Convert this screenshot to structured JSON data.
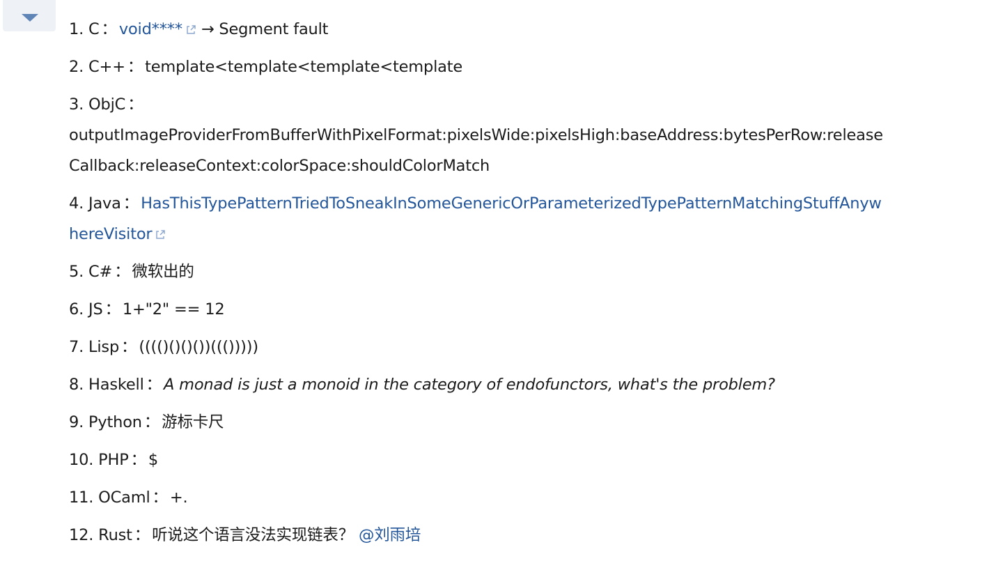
{
  "collapse_button": {
    "icon": "caret-down-icon",
    "color": "#5f84b6"
  },
  "link_color": "#225599",
  "separator": "：",
  "items": [
    {
      "num": "1.",
      "lang": "C",
      "link": "void****",
      "text": " → Segment fault"
    },
    {
      "num": "2.",
      "lang": "C++",
      "text": "template<template<template<template"
    },
    {
      "num": "3.",
      "lang": "ObjC",
      "text": "outputImageProviderFromBufferWithPixelFormat:pixelsWide:pixelsHigh:baseAddress:bytesPerRow:releaseCallback:releaseContext:colorSpace:shouldColorMatch"
    },
    {
      "num": "4.",
      "lang": "Java",
      "link": "HasThisTypePatternTriedToSneakInSomeGenericOrParameterizedTypePatternMatchingStuffAnywhereVisitor"
    },
    {
      "num": "5.",
      "lang": "C#",
      "text": "微软出的"
    },
    {
      "num": "6.",
      "lang": "JS",
      "text": "1+\"2\" == 12"
    },
    {
      "num": "7.",
      "lang": "Lisp",
      "text": "(((()()()())((()))))"
    },
    {
      "num": "8.",
      "lang": "Haskell",
      "text": "A monad is just a monoid in the category of endofunctors, what's the problem?"
    },
    {
      "num": "9.",
      "lang": "Python",
      "text": "游标卡尺"
    },
    {
      "num": "10.",
      "lang": "PHP",
      "text": "$"
    },
    {
      "num": "11.",
      "lang": "OCaml",
      "text": "+."
    },
    {
      "num": "12.",
      "lang": "Rust",
      "text": "听说这个语言没法实现链表？ ",
      "mention": "@刘雨培"
    }
  ]
}
